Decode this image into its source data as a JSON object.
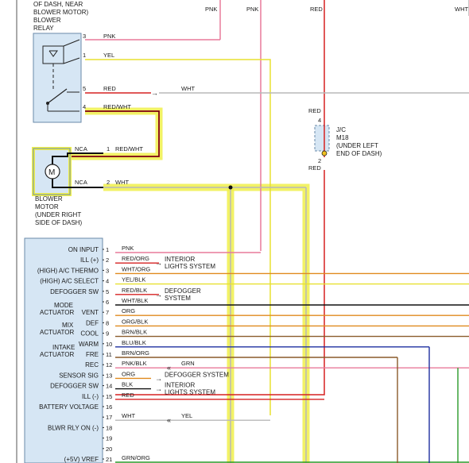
{
  "colors": {
    "pnk": "#e87a9a",
    "yel": "#e8e030",
    "red": "#d62020",
    "wht": "#b8b8b8",
    "org": "#e08a1e",
    "blu": "#1e2fa0",
    "brn": "#8a5a2a",
    "grn": "#2a9a2a",
    "blk": "#111111",
    "highlight": "#f0f04a",
    "component_fill": "#d6e6f4",
    "component_stroke": "#6a8aa8"
  },
  "relay": {
    "label_lines": [
      "OF DASH, NEAR",
      "BLOWER MOTOR)",
      "BLOWER",
      "RELAY"
    ],
    "pins": [
      {
        "num": "3",
        "wire": "PNK"
      },
      {
        "num": "1",
        "wire": "YEL"
      },
      {
        "num": "5",
        "wire": "RED",
        "far_wire": "WHT"
      },
      {
        "num": "4",
        "wire": "RED/WHT"
      }
    ]
  },
  "blower_motor": {
    "label_lines": [
      "BLOWER",
      "MOTOR",
      "(UNDER RIGHT",
      "SIDE OF DASH)"
    ],
    "motor_symbol": "M",
    "pins": [
      {
        "num": "1",
        "wire": "RED/WHT",
        "conn": "NCA"
      },
      {
        "num": "2",
        "wire": "WHT",
        "conn": "NCA"
      }
    ]
  },
  "top_wires": [
    {
      "label": "PNK"
    },
    {
      "label": "PNK"
    },
    {
      "label": "RED"
    },
    {
      "label": "WHT"
    }
  ],
  "junction": {
    "top_wire": "RED",
    "top_pin": "4",
    "bottom_pin": "2",
    "bottom_wire": "RED",
    "label_lines": [
      "J/C",
      "M18",
      "(UNDER LEFT",
      "END OF DASH)"
    ]
  },
  "control_module": {
    "rows": [
      {
        "label": "ON INPUT",
        "pin": "1",
        "wire": "PNK",
        "color": "pnk"
      },
      {
        "label": "ILL (+)",
        "pin": "2",
        "wire": "RED/ORG",
        "color": "red",
        "dest": [
          "INTERIOR",
          "LIGHTS SYSTEM"
        ]
      },
      {
        "label": "(HIGH) A/C THERMO",
        "pin": "3",
        "wire": "WHT/ORG",
        "color": "org"
      },
      {
        "label": "(HIGH) A/C SELECT",
        "pin": "4",
        "wire": "YEL/BLK",
        "color": "yel"
      },
      {
        "label": "DEFOGGER SW",
        "pin": "5",
        "wire": "RED/BLK",
        "color": "red",
        "dest": [
          "DEFOGGER",
          "SYSTEM"
        ]
      },
      {
        "label": "",
        "pin": "6",
        "wire": "WHT/BLK",
        "color": "blk"
      },
      {
        "label": "VENT",
        "pin": "7",
        "wire": "ORG",
        "color": "org"
      },
      {
        "label": "DEF",
        "pin": "8",
        "wire": "ORG/BLK",
        "color": "org"
      },
      {
        "label": "COOL",
        "pin": "9",
        "wire": "BRN/BLK",
        "color": "brn"
      },
      {
        "label": "WARM",
        "pin": "10",
        "wire": "BLU/BLK",
        "color": "blu"
      },
      {
        "label": "FRE",
        "pin": "11",
        "wire": "BRN/ORG",
        "color": "brn"
      },
      {
        "label": "REC",
        "pin": "12",
        "wire": "PNK/BLK",
        "color": "pnk",
        "far_wire": "GRN"
      },
      {
        "label": "SENSOR SIG",
        "pin": "13",
        "wire": "ORG",
        "color": "org",
        "dest": [
          "DEFOGGER SYSTEM"
        ]
      },
      {
        "label": "DEFOGGER SW",
        "pin": "14",
        "wire": "BLK",
        "color": "blk",
        "dest": [
          "INTERIOR",
          "LIGHTS SYSTEM"
        ]
      },
      {
        "label": "ILL (-)",
        "pin": "15",
        "wire": "RED",
        "color": "red"
      },
      {
        "label": "BATTERY VOLTAGE",
        "pin": "16",
        "wire": "",
        "color": ""
      },
      {
        "label": "",
        "pin": "17",
        "wire": "WHT",
        "color": "wht",
        "far_wire": "YEL"
      },
      {
        "label": "BLWR RLY ON (-)",
        "pin": "18",
        "wire": "",
        "color": ""
      },
      {
        "label": "",
        "pin": "19",
        "wire": "",
        "color": ""
      },
      {
        "label": "",
        "pin": "20",
        "wire": "",
        "color": ""
      },
      {
        "label": "(+5V) VREF",
        "pin": "21",
        "wire": "GRN/ORG",
        "color": "grn"
      }
    ],
    "group_labels": [
      {
        "lines": [
          "MODE",
          "ACTUATOR"
        ]
      },
      {
        "lines": [
          "MIX",
          "ACTUATOR"
        ]
      },
      {
        "lines": [
          "INTAKE",
          "ACTUATOR"
        ]
      }
    ]
  }
}
